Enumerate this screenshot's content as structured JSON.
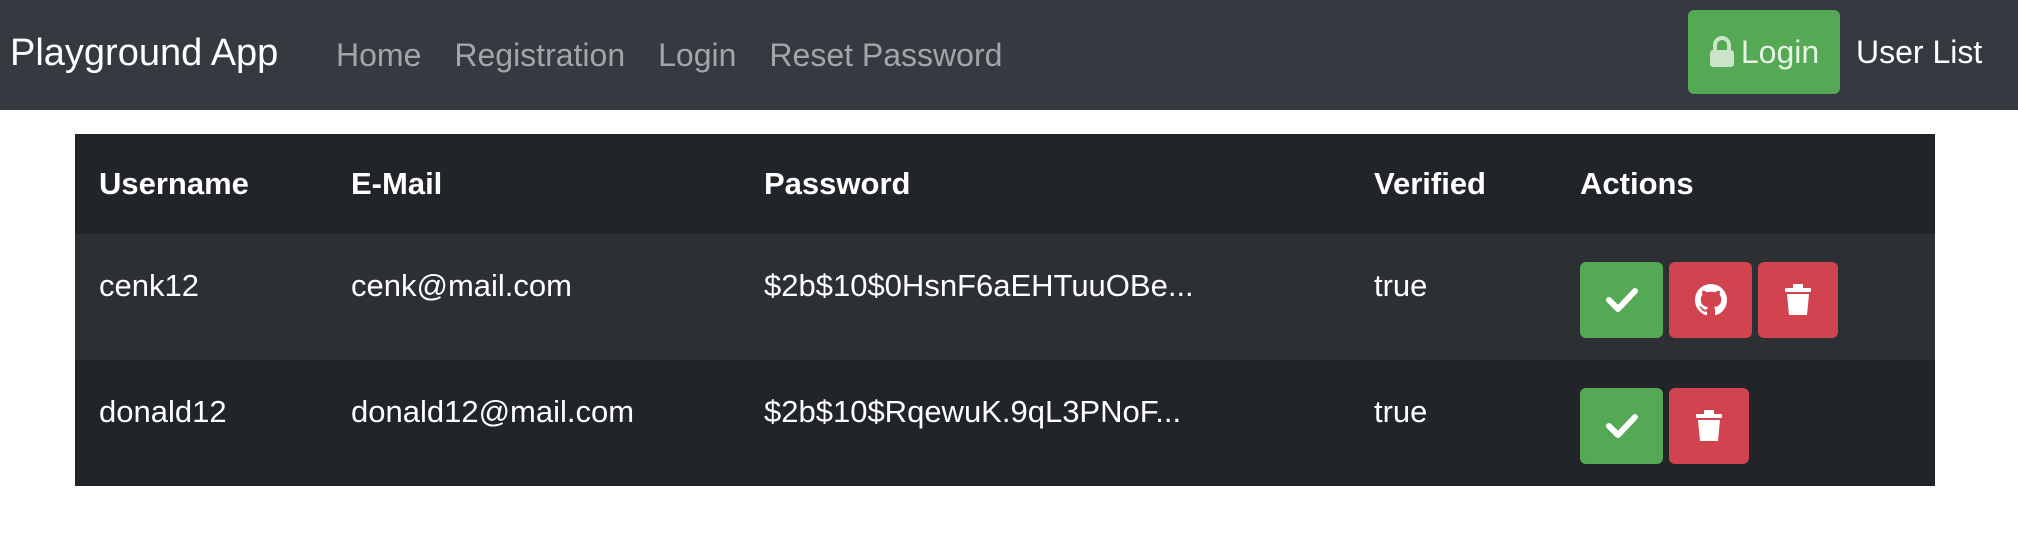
{
  "navbar": {
    "brand": "Playground App",
    "links": [
      "Home",
      "Registration",
      "Login",
      "Reset Password"
    ],
    "login_button": "Login",
    "user_list": "User List"
  },
  "table": {
    "headers": [
      "Username",
      "E-Mail",
      "Password",
      "Verified",
      "Actions"
    ],
    "rows": [
      {
        "username": "cenk12",
        "email": "cenk@mail.com",
        "password": "$2b$10$0HsnF6aEHTuuOBe...",
        "verified": "true",
        "actions": [
          "verify",
          "github",
          "delete"
        ]
      },
      {
        "username": "donald12",
        "email": "donald12@mail.com",
        "password": "$2b$10$RqewuK.9qL3PNoF...",
        "verified": "true",
        "actions": [
          "verify",
          "delete"
        ]
      }
    ]
  },
  "colors": {
    "navbar_bg": "#343a40",
    "success": "#55a854",
    "danger": "#d0434f",
    "table_dark": "#212529",
    "table_stripe": "#2c3034"
  },
  "icons": {
    "login": "lock-icon",
    "verify": "check-icon",
    "github": "github-icon",
    "delete": "trash-icon"
  }
}
